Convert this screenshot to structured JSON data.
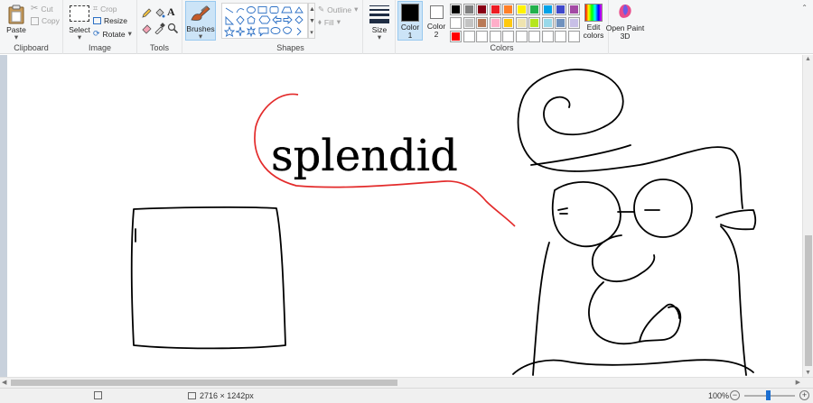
{
  "clipboard": {
    "paste": "Paste",
    "cut": "Cut",
    "copy": "Copy",
    "label": "Clipboard"
  },
  "image": {
    "select": "Select",
    "crop": "Crop",
    "resize": "Resize",
    "rotate": "Rotate",
    "label": "Image"
  },
  "tools": {
    "label": "Tools"
  },
  "brushes": {
    "label": "Brushes"
  },
  "shapes": {
    "label": "Shapes",
    "outline": "Outline",
    "fill": "Fill"
  },
  "size": {
    "label": "Size"
  },
  "colors": {
    "color1": "Color 1",
    "color2": "Color 2",
    "edit": "Edit colors",
    "label": "Colors",
    "color1_value": "#000000",
    "color2_value": "#ffffff",
    "palette_row1": [
      "#000000",
      "#7f7f7f",
      "#880015",
      "#ed1c24",
      "#ff7f27",
      "#fff200",
      "#22b14c",
      "#00a2e8",
      "#3f48cc",
      "#a349a4"
    ],
    "palette_row2": [
      "#ffffff",
      "#c3c3c3",
      "#b97a57",
      "#ffaec9",
      "#ffc90e",
      "#efe4b0",
      "#b5e61d",
      "#99d9ea",
      "#7092be",
      "#c8bfe7"
    ],
    "palette_row3": [
      "#ff0000",
      "#ffffff",
      "#ffffff",
      "#ffffff",
      "#ffffff",
      "#ffffff",
      "#ffffff",
      "#ffffff",
      "#ffffff",
      "#ffffff"
    ]
  },
  "paint3d": {
    "label": "Open Paint 3D"
  },
  "canvas": {
    "text": "splendid",
    "stroke": "#000000",
    "bubble": "#e32b2b"
  },
  "status": {
    "dimensions": "2716 × 1242px",
    "zoom": "100%"
  }
}
